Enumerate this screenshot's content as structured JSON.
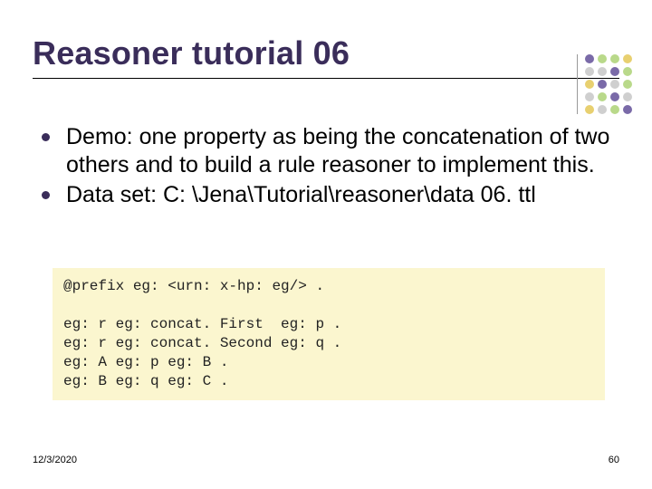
{
  "title": "Reasoner tutorial 06",
  "bullets": [
    "Demo: one property as being the concatenation of two others and to build a rule reasoner to implement this.",
    "Data set: C: \\Jena\\Tutorial\\reasoner\\data 06. ttl"
  ],
  "code": "@prefix eg: <urn: x-hp: eg/> .\n\neg: r eg: concat. First  eg: p .\neg: r eg: concat. Second eg: q .\neg: A eg: p eg: B .\neg: B eg: q eg: C .",
  "footer": {
    "date": "12/3/2020",
    "page": "60"
  },
  "decor_grid": [
    [
      "c-purple",
      "c-green",
      "c-green",
      "c-yellow"
    ],
    [
      "c-gray",
      "c-gray",
      "c-purple",
      "c-green"
    ],
    [
      "c-yellow",
      "c-purple",
      "c-gray",
      "c-green"
    ],
    [
      "c-gray",
      "c-green",
      "c-purple",
      "c-gray"
    ],
    [
      "c-yellow",
      "c-gray",
      "c-green",
      "c-purple"
    ]
  ]
}
